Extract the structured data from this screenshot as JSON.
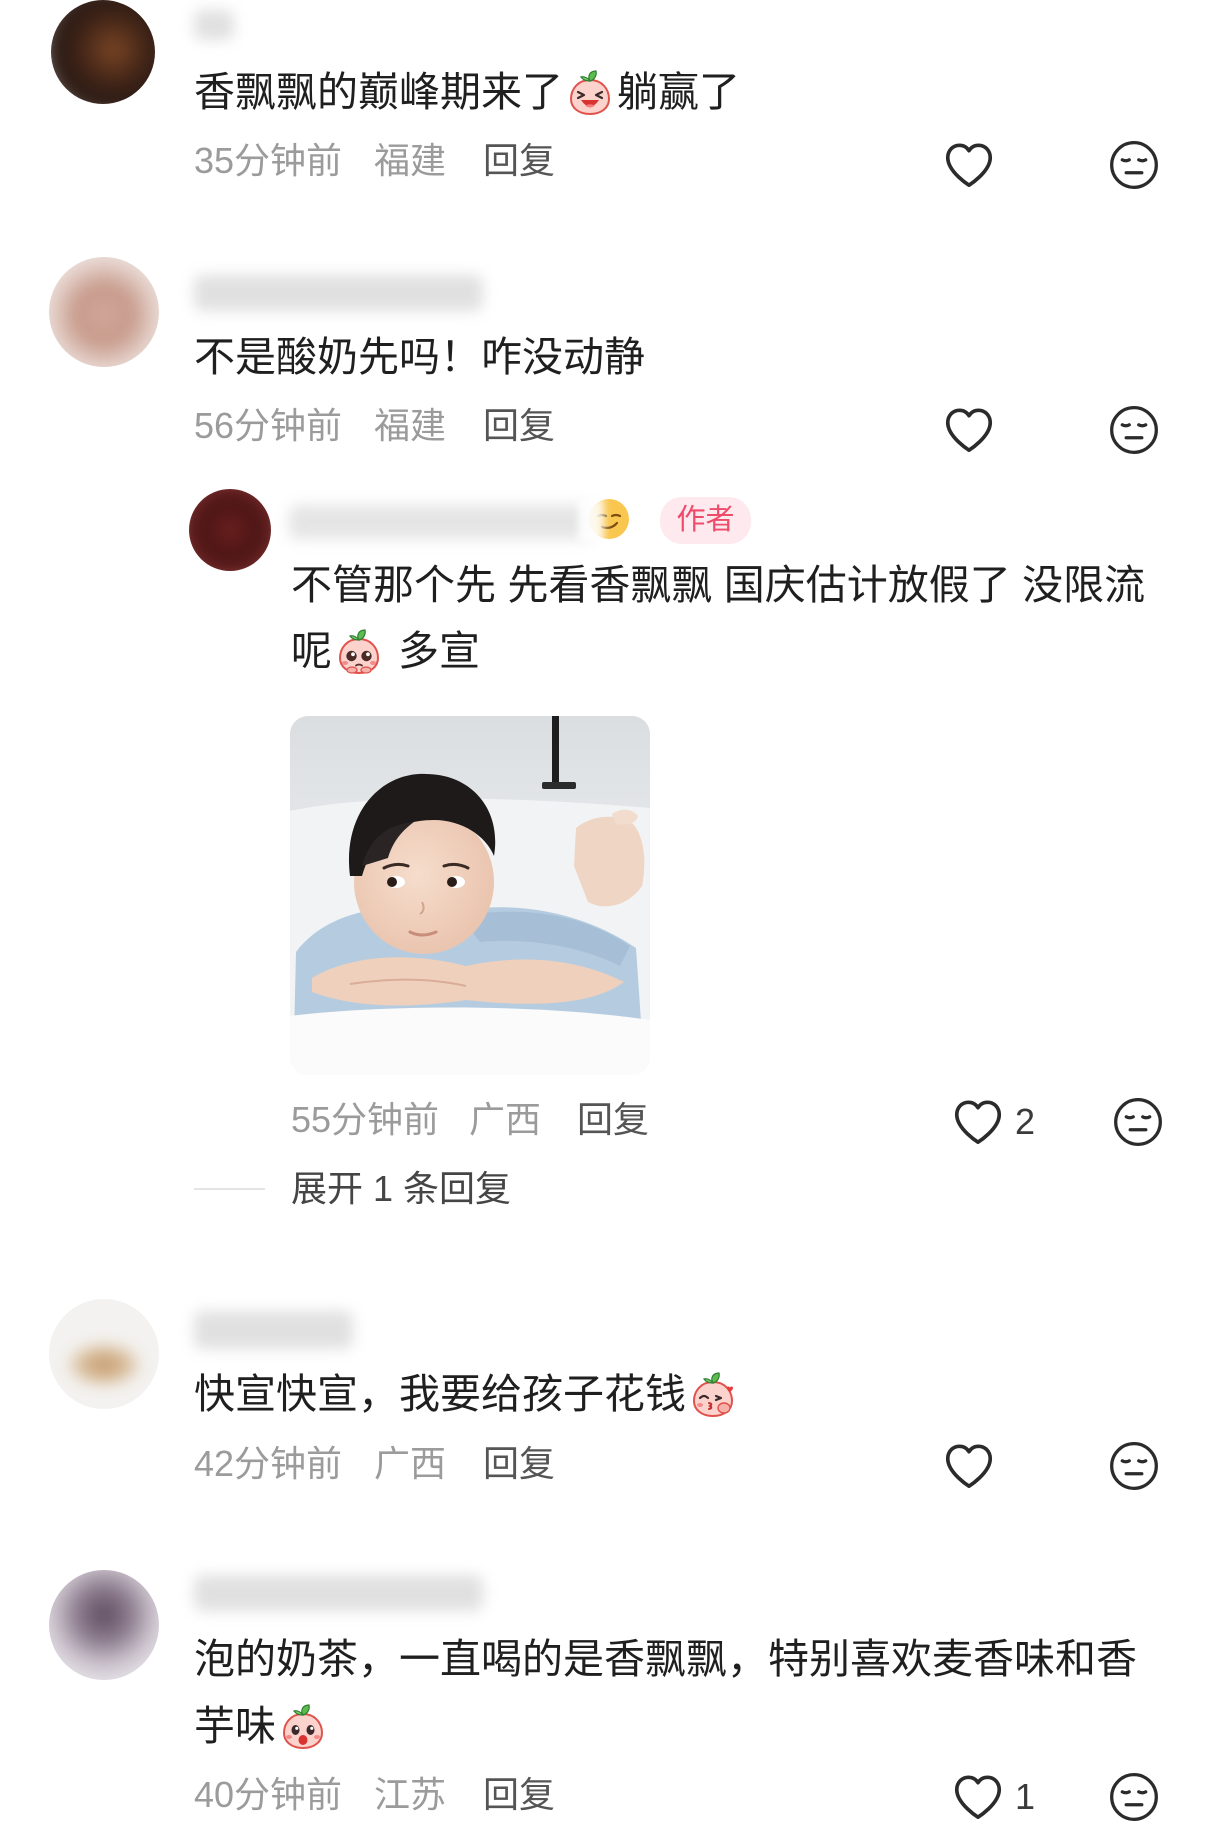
{
  "colors": {
    "background": "#ffffff",
    "text": "#1f1f1f",
    "meta": "#9b9b9b",
    "reply_link": "#555555",
    "icon": "#2b2b2b",
    "author_badge_bg": "#fde9ee",
    "author_badge_text": "#ef4b6a",
    "divider": "#e4e4e4"
  },
  "comments": [
    {
      "text_before": "香飘飘的巅峰期来了",
      "emoji": "peach-laughing-emoji",
      "text_after": "躺赢了",
      "time": "35分钟前",
      "location": "福建",
      "reply_label": "回复",
      "like_icon": "heart-outline-icon",
      "dislike_icon": "expressionless-face-icon"
    },
    {
      "text": "不是酸奶先吗！咋没动静",
      "time": "56分钟前",
      "location": "福建",
      "reply_label": "回复",
      "like_icon": "heart-outline-icon",
      "dislike_icon": "expressionless-face-icon",
      "replies": [
        {
          "name_emoji": "smirking-face-emoji",
          "author_badge": "作者",
          "text_line1": "不管那个先 先看香飘飘 国庆估计放假了 没限流",
          "text_line2_before": "呢",
          "emoji": "peach-pleading-emoji",
          "text_line2_after": "多宣",
          "time": "55分钟前",
          "location": "广西",
          "reply_label": "回复",
          "like_count": "2",
          "like_icon": "heart-outline-icon",
          "dislike_icon": "expressionless-face-icon"
        }
      ],
      "expand_replies_label": "展开 1 条回复"
    },
    {
      "text_before": "快宣快宣，我要给孩子花钱",
      "emoji": "peach-blowing-kiss-emoji",
      "time": "42分钟前",
      "location": "广西",
      "reply_label": "回复",
      "like_icon": "heart-outline-icon",
      "dislike_icon": "expressionless-face-icon"
    },
    {
      "text_line1": "泡的奶茶，一直喝的是香飘飘，特别喜欢麦香味和香",
      "text_line2_before": "芋味",
      "emoji": "peach-surprised-emoji",
      "time": "40分钟前",
      "location": "江苏",
      "reply_label": "回复",
      "like_count": "1",
      "like_icon": "heart-outline-icon",
      "dislike_icon": "expressionless-face-icon"
    }
  ]
}
